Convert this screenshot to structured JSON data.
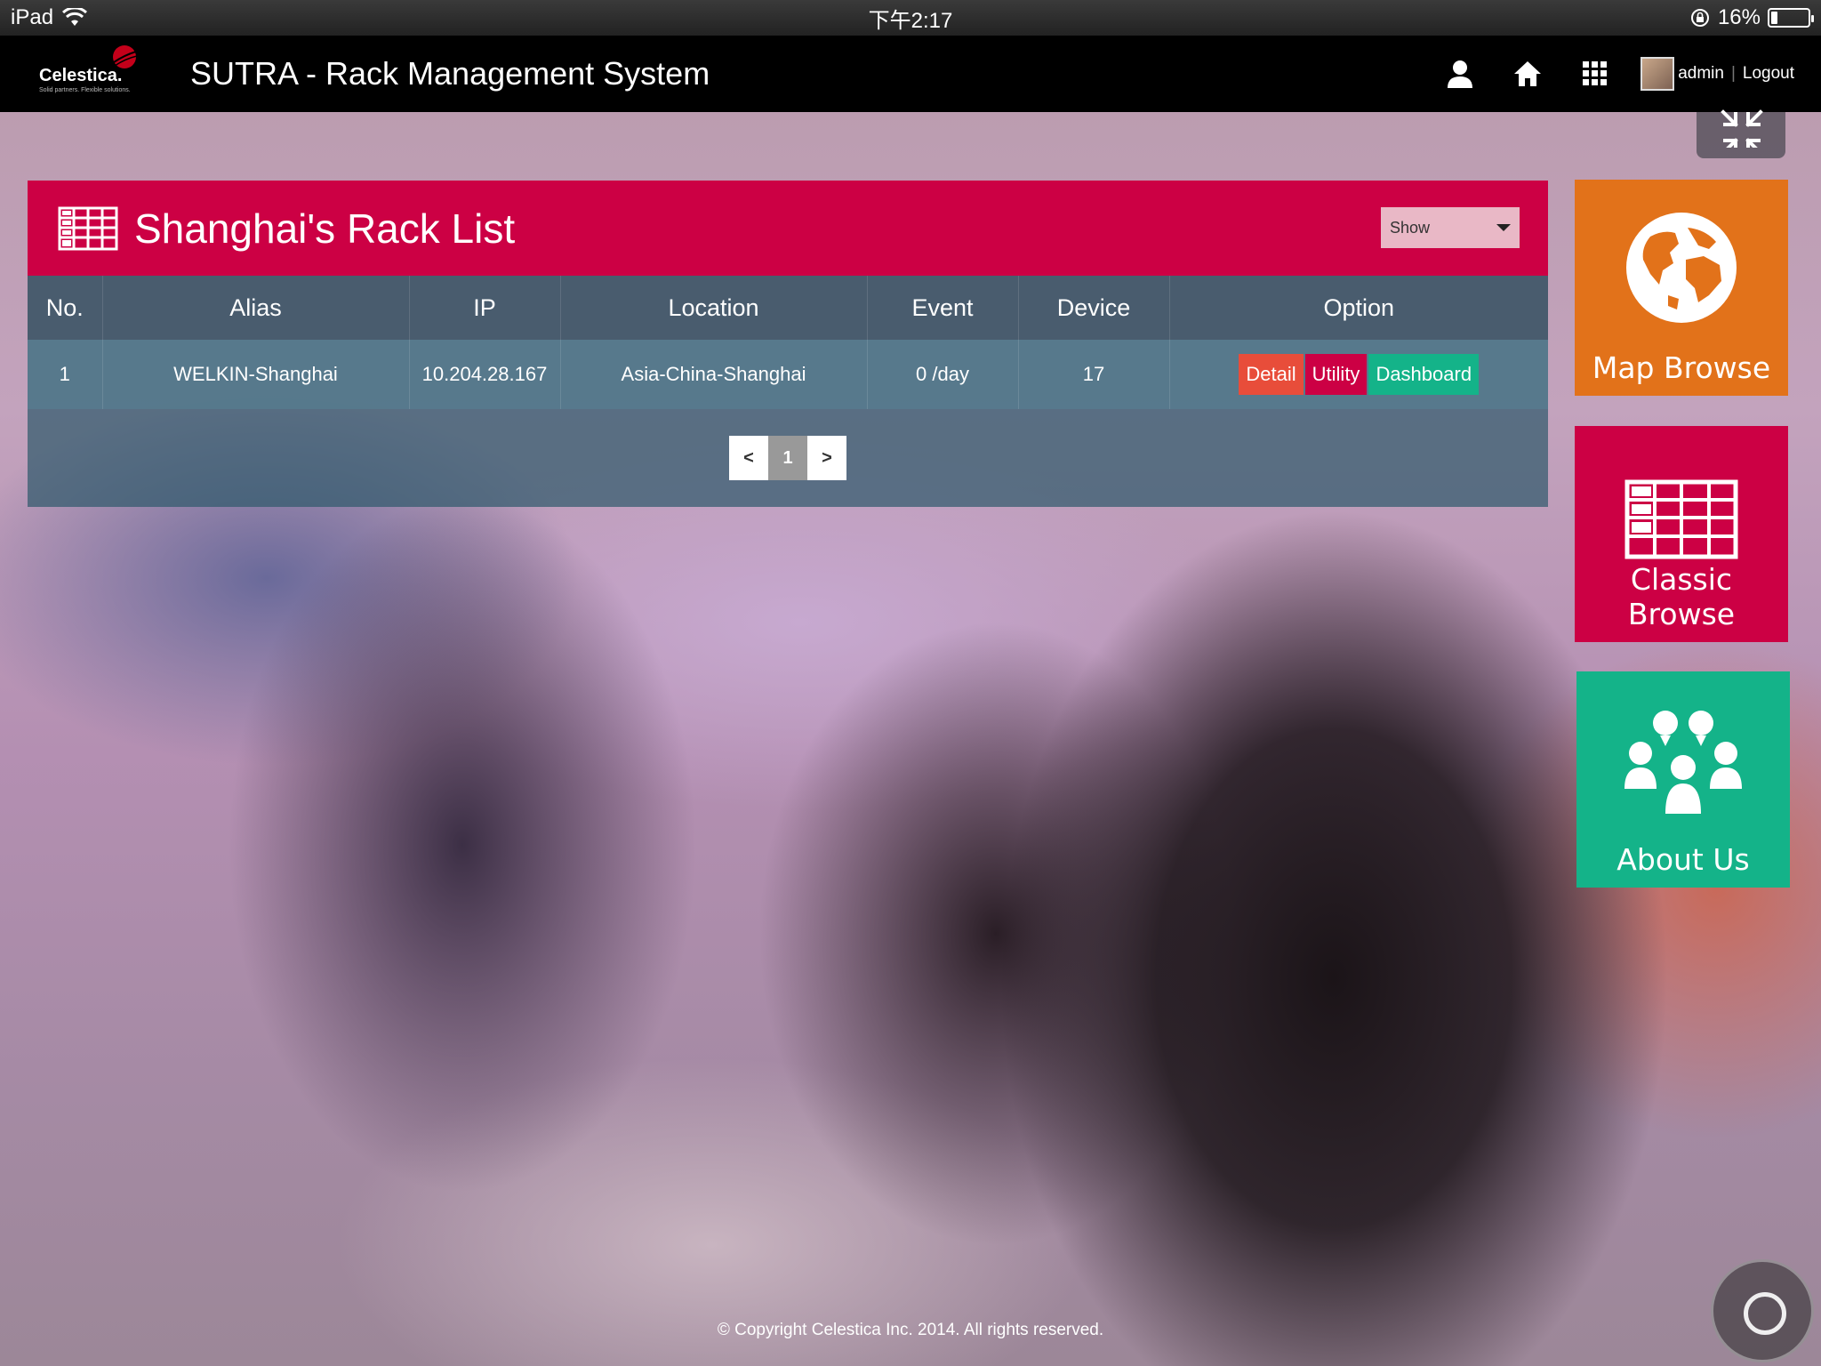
{
  "status_bar": {
    "device": "iPad",
    "time": "下午2:17",
    "battery": "16%",
    "battery_level": 0.16
  },
  "header": {
    "logo_text": "Celestica.",
    "logo_tagline": "Solid partners. Flexible solutions.",
    "title": "SUTRA - Rack Management System",
    "user_name": "admin",
    "logout_label": "Logout",
    "icons": [
      "user-icon",
      "home-icon",
      "grid-apps-icon",
      "collapse-icon"
    ]
  },
  "rack_list": {
    "title": "Shanghai's Rack List",
    "show_label": "Show",
    "columns": [
      "No.",
      "Alias",
      "IP",
      "Location",
      "Event",
      "Device",
      "Option"
    ],
    "rows": [
      {
        "no": "1",
        "alias": "WELKIN-Shanghai",
        "ip": "10.204.28.167",
        "location": "Asia-China-Shanghai",
        "event": "0 /day",
        "device": "17",
        "options": [
          "Detail",
          "Utility",
          "Dashboard"
        ]
      }
    ],
    "pagination": {
      "prev": "<",
      "current": "1",
      "next": ">"
    }
  },
  "tiles": [
    {
      "label": "Map Browse",
      "icon": "globe-icon",
      "color": "#e2721a"
    },
    {
      "label": "Classic Browse",
      "icon": "table-icon",
      "color": "#cc0044"
    },
    {
      "label": "About Us",
      "icon": "people-icon",
      "color": "#14b389"
    }
  ],
  "colors": {
    "accent": "#cc0044",
    "detail": "#e84d3a",
    "dashboard": "#14b389",
    "map_tile": "#e2721a"
  },
  "footer": {
    "copyright": "© Copyright Celestica Inc. 2014. All rights reserved."
  }
}
